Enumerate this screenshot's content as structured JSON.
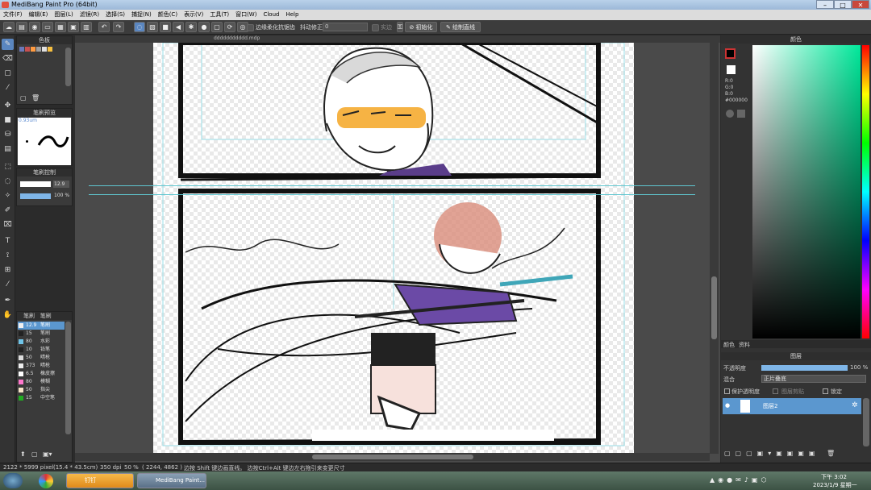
{
  "window": {
    "title": "MediBang Paint Pro (64bit)"
  },
  "menu": [
    "文件(F)",
    "编辑(E)",
    "图层(L)",
    "滤镜(R)",
    "选择(S)",
    "捕捉(N)",
    "颜色(C)",
    "表示(V)",
    "工具(T)",
    "窗口(W)",
    "Cloud",
    "Help"
  ],
  "toolbar": {
    "antialias_label": "边缘柔化抗锯齿",
    "stabilizer_label": "抖动修正",
    "stabilizer_value": "0",
    "stroke_label": "实边",
    "init_button": "初始化",
    "line_button": "绘制直线"
  },
  "document": {
    "tab_title": "ddddddddddd.mdp"
  },
  "panels": {
    "palette_title": "色板",
    "palette_colors": [
      "#6b78b8",
      "#c85050",
      "#ff9a40",
      "#a0a0a0",
      "#e0e0e0",
      "#f7c040"
    ],
    "brush_preview_title": "笔刷预览",
    "brush_preview_size": "0.93um",
    "brush_control_title": "笔刷控制",
    "brush_size": "12.9",
    "brush_opacity": "100 %",
    "brush_list_title": "笔刷",
    "brush_list_title2": "笔刷",
    "brushes": [
      {
        "size": "12.9",
        "name": "笔刷",
        "color": "#f0f0f0",
        "selected": true
      },
      {
        "size": "15",
        "name": "笔刷",
        "color": "#222222",
        "selected": false
      },
      {
        "size": "80",
        "name": "水彩",
        "color": "#6fc4e8",
        "selected": false
      },
      {
        "size": "10",
        "name": "铅笔",
        "color": "#222222",
        "selected": false
      },
      {
        "size": "50",
        "name": "晴枪",
        "color": "#dddddd",
        "selected": false
      },
      {
        "size": "373",
        "name": "晴枪",
        "color": "#eeeeee",
        "selected": false
      },
      {
        "size": "6.5",
        "name": "橡皮擦",
        "color": "#ffffff",
        "selected": false
      },
      {
        "size": "80",
        "name": "模糊",
        "color": "#ff77cc",
        "selected": false
      },
      {
        "size": "50",
        "name": "指尖",
        "color": "#f8e4c8",
        "selected": false
      },
      {
        "size": "15",
        "name": "中空笔",
        "color": "#22aa22",
        "selected": false
      }
    ]
  },
  "color_panel": {
    "title": "颜色",
    "r": "R:0",
    "g": "G:0",
    "b": "B:0",
    "hex": "#000000",
    "fg": "#000000",
    "bg": "#ffffff",
    "tabs": [
      "颜色",
      "资料"
    ]
  },
  "layer_panel": {
    "title": "图层",
    "opacity_label": "不透明度",
    "opacity_value": "100 %",
    "opacity_fraction": 1.0,
    "blend_label": "混合",
    "blend_value": "正片叠底",
    "protect_alpha": "保护透明度",
    "clipping": "图层剪贴",
    "lock": "锁定",
    "layers": [
      {
        "name": "图层2",
        "visible": true
      }
    ]
  },
  "status": {
    "size": "2122 * 5999 pixel",
    "cm": "(15.4 * 43.5cm)",
    "dpi": "350 dpi",
    "zoom": "50 %",
    "coords": "( 2244, 4862 )",
    "hint": "边按 Shift 键边画直线。 边按Ctrl+Alt 键边左右拖引来变更尺寸"
  },
  "taskbar": {
    "apps": [
      "钉钉",
      "MediBang Paint..."
    ],
    "time": "下午 3:02",
    "date": "2023/1/9 星期一"
  }
}
